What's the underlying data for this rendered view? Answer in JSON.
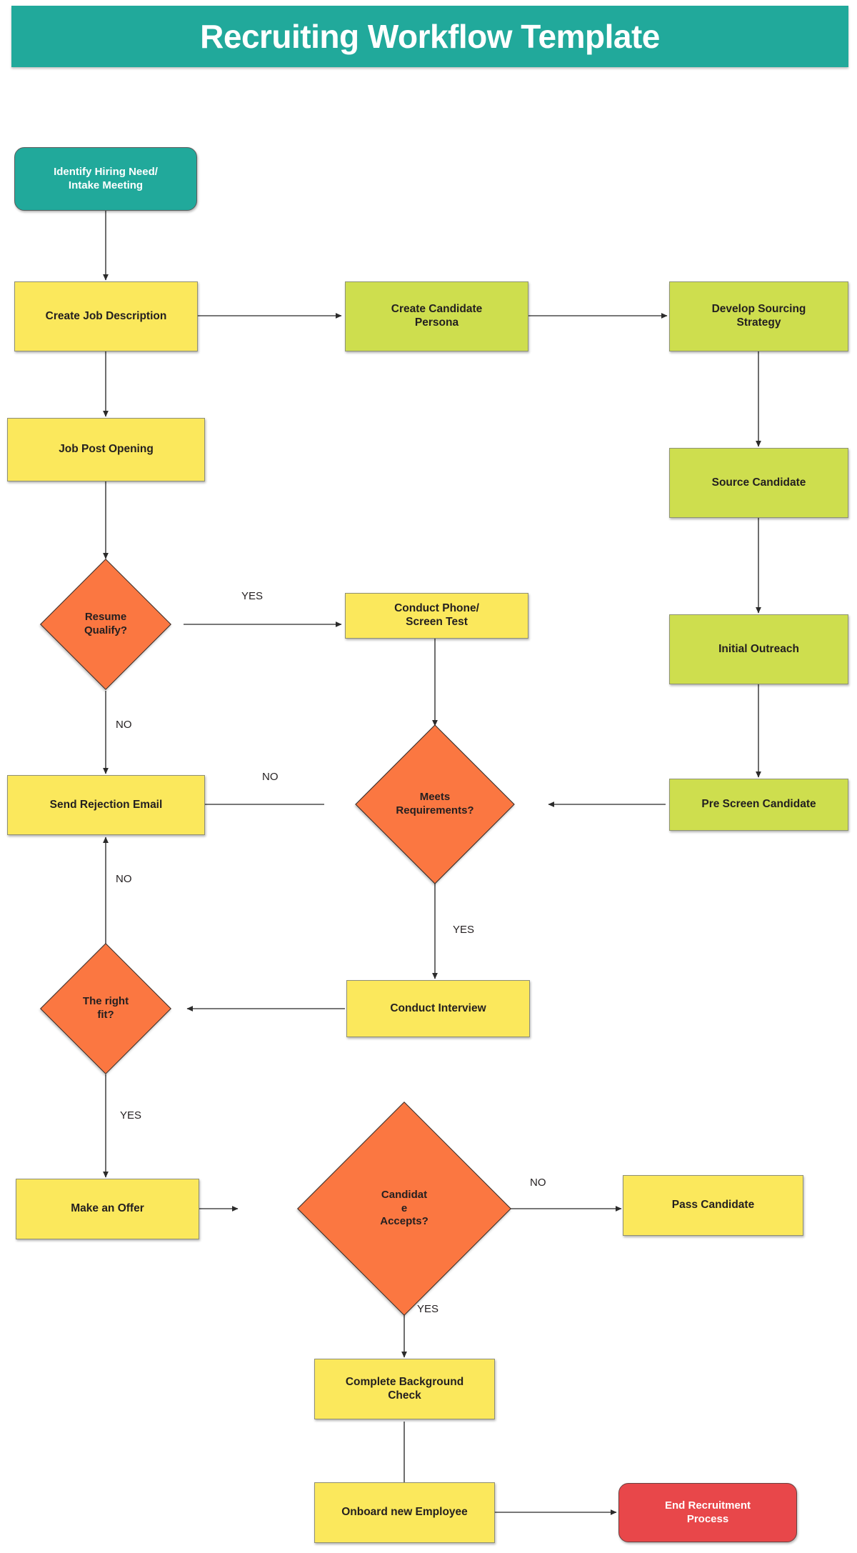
{
  "header": {
    "title": "Recruiting Workflow Template",
    "background_color": "#21A99B",
    "text_color": "#FFFFFF"
  },
  "palette": {
    "teal": "#21A99B",
    "yellow": "#FBE85C",
    "green": "#CEDE4E",
    "orange": "#FB7741",
    "red": "#E8474A",
    "line": "#3a3a3a",
    "text_dark": "#231F20"
  },
  "chart_data": {
    "type": "diagram",
    "title": "Recruiting Workflow Template",
    "nodes": [
      {
        "id": "n1",
        "label": "Identify Hiring Need/\nIntake Meeting",
        "shape": "rounded-terminator",
        "color": "#21A99B"
      },
      {
        "id": "n2",
        "label": "Create Job Description",
        "shape": "rectangle",
        "color": "#FBE85C"
      },
      {
        "id": "n3",
        "label": "Create Candidate\nPersona",
        "shape": "rectangle",
        "color": "#CEDE4E"
      },
      {
        "id": "n4",
        "label": "Develop Sourcing\nStrategy",
        "shape": "rectangle",
        "color": "#CEDE4E"
      },
      {
        "id": "n5",
        "label": "Job Post Opening",
        "shape": "rectangle",
        "color": "#FBE85C"
      },
      {
        "id": "n6",
        "label": "Source Candidate",
        "shape": "rectangle",
        "color": "#CEDE4E"
      },
      {
        "id": "n7",
        "label": "Resume\nQualify?",
        "shape": "diamond",
        "color": "#FB7741"
      },
      {
        "id": "n8",
        "label": "Conduct Phone/\nScreen Test",
        "shape": "rectangle",
        "color": "#FBE85C"
      },
      {
        "id": "n9",
        "label": "Initial Outreach",
        "shape": "rectangle",
        "color": "#CEDE4E"
      },
      {
        "id": "n10",
        "label": "Send Rejection Email",
        "shape": "rectangle",
        "color": "#FBE85C"
      },
      {
        "id": "n11",
        "label": "Meets\nRequirements?",
        "shape": "diamond",
        "color": "#FB7741"
      },
      {
        "id": "n12",
        "label": "Pre Screen Candidate",
        "shape": "rectangle",
        "color": "#CEDE4E"
      },
      {
        "id": "n13",
        "label": "The right\nfit?",
        "shape": "diamond",
        "color": "#FB7741"
      },
      {
        "id": "n14",
        "label": "Conduct Interview",
        "shape": "rectangle",
        "color": "#FBE85C"
      },
      {
        "id": "n15",
        "label": "Make an Offer",
        "shape": "rectangle",
        "color": "#FBE85C"
      },
      {
        "id": "n16",
        "label": "Candidat\ne\nAccepts?",
        "shape": "diamond",
        "color": "#FB7741"
      },
      {
        "id": "n17",
        "label": "Pass Candidate",
        "shape": "rectangle",
        "color": "#FBE85C"
      },
      {
        "id": "n18",
        "label": "Complete Background\nCheck",
        "shape": "rectangle",
        "color": "#FBE85C"
      },
      {
        "id": "n19",
        "label": "Onboard new Employee",
        "shape": "rectangle",
        "color": "#FBE85C"
      },
      {
        "id": "n20",
        "label": "End Recruitment\nProcess",
        "shape": "rounded-terminator",
        "color": "#E8474A"
      }
    ],
    "edges": [
      {
        "from": "n1",
        "to": "n2",
        "label": ""
      },
      {
        "from": "n2",
        "to": "n3",
        "label": ""
      },
      {
        "from": "n3",
        "to": "n4",
        "label": ""
      },
      {
        "from": "n2",
        "to": "n5",
        "label": ""
      },
      {
        "from": "n4",
        "to": "n6",
        "label": ""
      },
      {
        "from": "n5",
        "to": "n7",
        "label": ""
      },
      {
        "from": "n7",
        "to": "n8",
        "label": "YES"
      },
      {
        "from": "n7",
        "to": "n10",
        "label": "NO"
      },
      {
        "from": "n6",
        "to": "n9",
        "label": ""
      },
      {
        "from": "n8",
        "to": "n11",
        "label": ""
      },
      {
        "from": "n9",
        "to": "n12",
        "label": ""
      },
      {
        "from": "n11",
        "to": "n10",
        "label": "NO"
      },
      {
        "from": "n12",
        "to": "n11",
        "label": ""
      },
      {
        "from": "n11",
        "to": "n14",
        "label": "YES"
      },
      {
        "from": "n14",
        "to": "n13",
        "label": ""
      },
      {
        "from": "n13",
        "to": "n10",
        "label": "NO"
      },
      {
        "from": "n13",
        "to": "n15",
        "label": "YES"
      },
      {
        "from": "n15",
        "to": "n16",
        "label": ""
      },
      {
        "from": "n16",
        "to": "n17",
        "label": "NO"
      },
      {
        "from": "n16",
        "to": "n18",
        "label": "YES"
      },
      {
        "from": "n18",
        "to": "n19",
        "label": ""
      },
      {
        "from": "n19",
        "to": "n20",
        "label": ""
      }
    ]
  },
  "nodes": {
    "identify_hiring_need": {
      "line1": "Identify Hiring Need/",
      "line2": "Intake Meeting"
    },
    "create_job_description": {
      "line1": "Create Job Description"
    },
    "create_candidate_persona": {
      "line1": "Create Candidate",
      "line2": "Persona"
    },
    "develop_sourcing_strategy": {
      "line1": "Develop Sourcing",
      "line2": "Strategy"
    },
    "job_post_opening": {
      "line1": "Job Post Opening"
    },
    "source_candidate": {
      "line1": "Source Candidate"
    },
    "resume_qualify": {
      "line1": "Resume",
      "line2": "Qualify?"
    },
    "conduct_phone_screen": {
      "line1": "Conduct Phone/",
      "line2": "Screen Test"
    },
    "initial_outreach": {
      "line1": "Initial Outreach"
    },
    "send_rejection_email": {
      "line1": "Send Rejection Email"
    },
    "meets_requirements": {
      "line1": "Meets",
      "line2": "Requirements?"
    },
    "pre_screen_candidate": {
      "line1": "Pre Screen Candidate"
    },
    "the_right_fit": {
      "line1": "The right",
      "line2": "fit?"
    },
    "conduct_interview": {
      "line1": "Conduct Interview"
    },
    "make_an_offer": {
      "line1": "Make an Offer"
    },
    "candidate_accepts": {
      "line1": "Candidat",
      "line2": "e",
      "line3": "Accepts?"
    },
    "pass_candidate": {
      "line1": "Pass Candidate"
    },
    "complete_background_check": {
      "line1": "Complete Background",
      "line2": "Check"
    },
    "onboard_new_employee": {
      "line1": "Onboard new Employee"
    },
    "end_recruitment_process": {
      "line1": "End Recruitment",
      "line2": "Process"
    }
  },
  "edge_labels": {
    "resume_qualify_yes": "YES",
    "resume_qualify_no": "NO",
    "meets_requirements_no": "NO",
    "meets_requirements_yes": "YES",
    "right_fit_no": "NO",
    "right_fit_yes": "YES",
    "candidate_accepts_no": "NO",
    "candidate_accepts_yes": "YES"
  }
}
